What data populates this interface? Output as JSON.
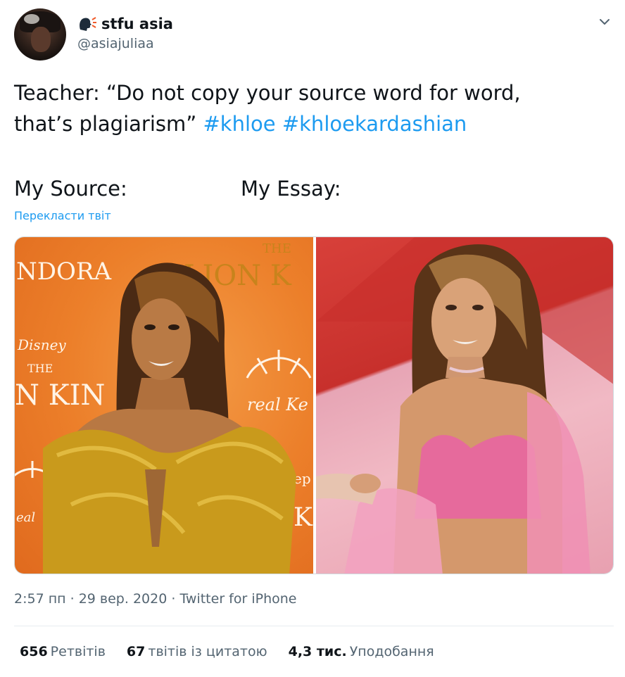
{
  "user": {
    "display_name": "stfu asia",
    "handle": "@asiajuliaa",
    "name_icon": "speaking-head-icon",
    "avatar": "avatar-photo"
  },
  "menu_icon": "chevron-down-icon",
  "tweet": {
    "text_line1": "Teacher: “Do not copy your source word for word,",
    "text_line2": "that’s plagiarism”",
    "hashtags": [
      "#khloe",
      "#khloekardashian"
    ],
    "label_source": "My Source:",
    "label_essay": "My Essay:",
    "translate_link": "Перекласти твіт"
  },
  "media": {
    "left_photo": {
      "backdrop_text_top": "NDORA",
      "backdrop_the": "THE",
      "backdrop_lion": "LION K",
      "backdrop_disney": "Disney",
      "backdrop_the2": "THE",
      "backdrop_nkin": "N KIN",
      "backdrop_real": "real Ke",
      "backdrop_ep": "ep",
      "backdrop_k": "K",
      "backdrop_eal": "eal"
    },
    "right_photo": {}
  },
  "meta": {
    "time": "2:57 пп",
    "sep1": "·",
    "date": "29 вер. 2020",
    "sep2": "·",
    "source": "Twitter for iPhone"
  },
  "stats": {
    "retweets_count": "656",
    "retweets_label": "Ретвітів",
    "quotes_count": "67",
    "quotes_label": "твітів із цитатою",
    "likes_count": "4,3 тис.",
    "likes_label": "Уподобання"
  },
  "colors": {
    "link": "#1d9bf0",
    "text": "#0f1419",
    "secondary": "#536471"
  }
}
